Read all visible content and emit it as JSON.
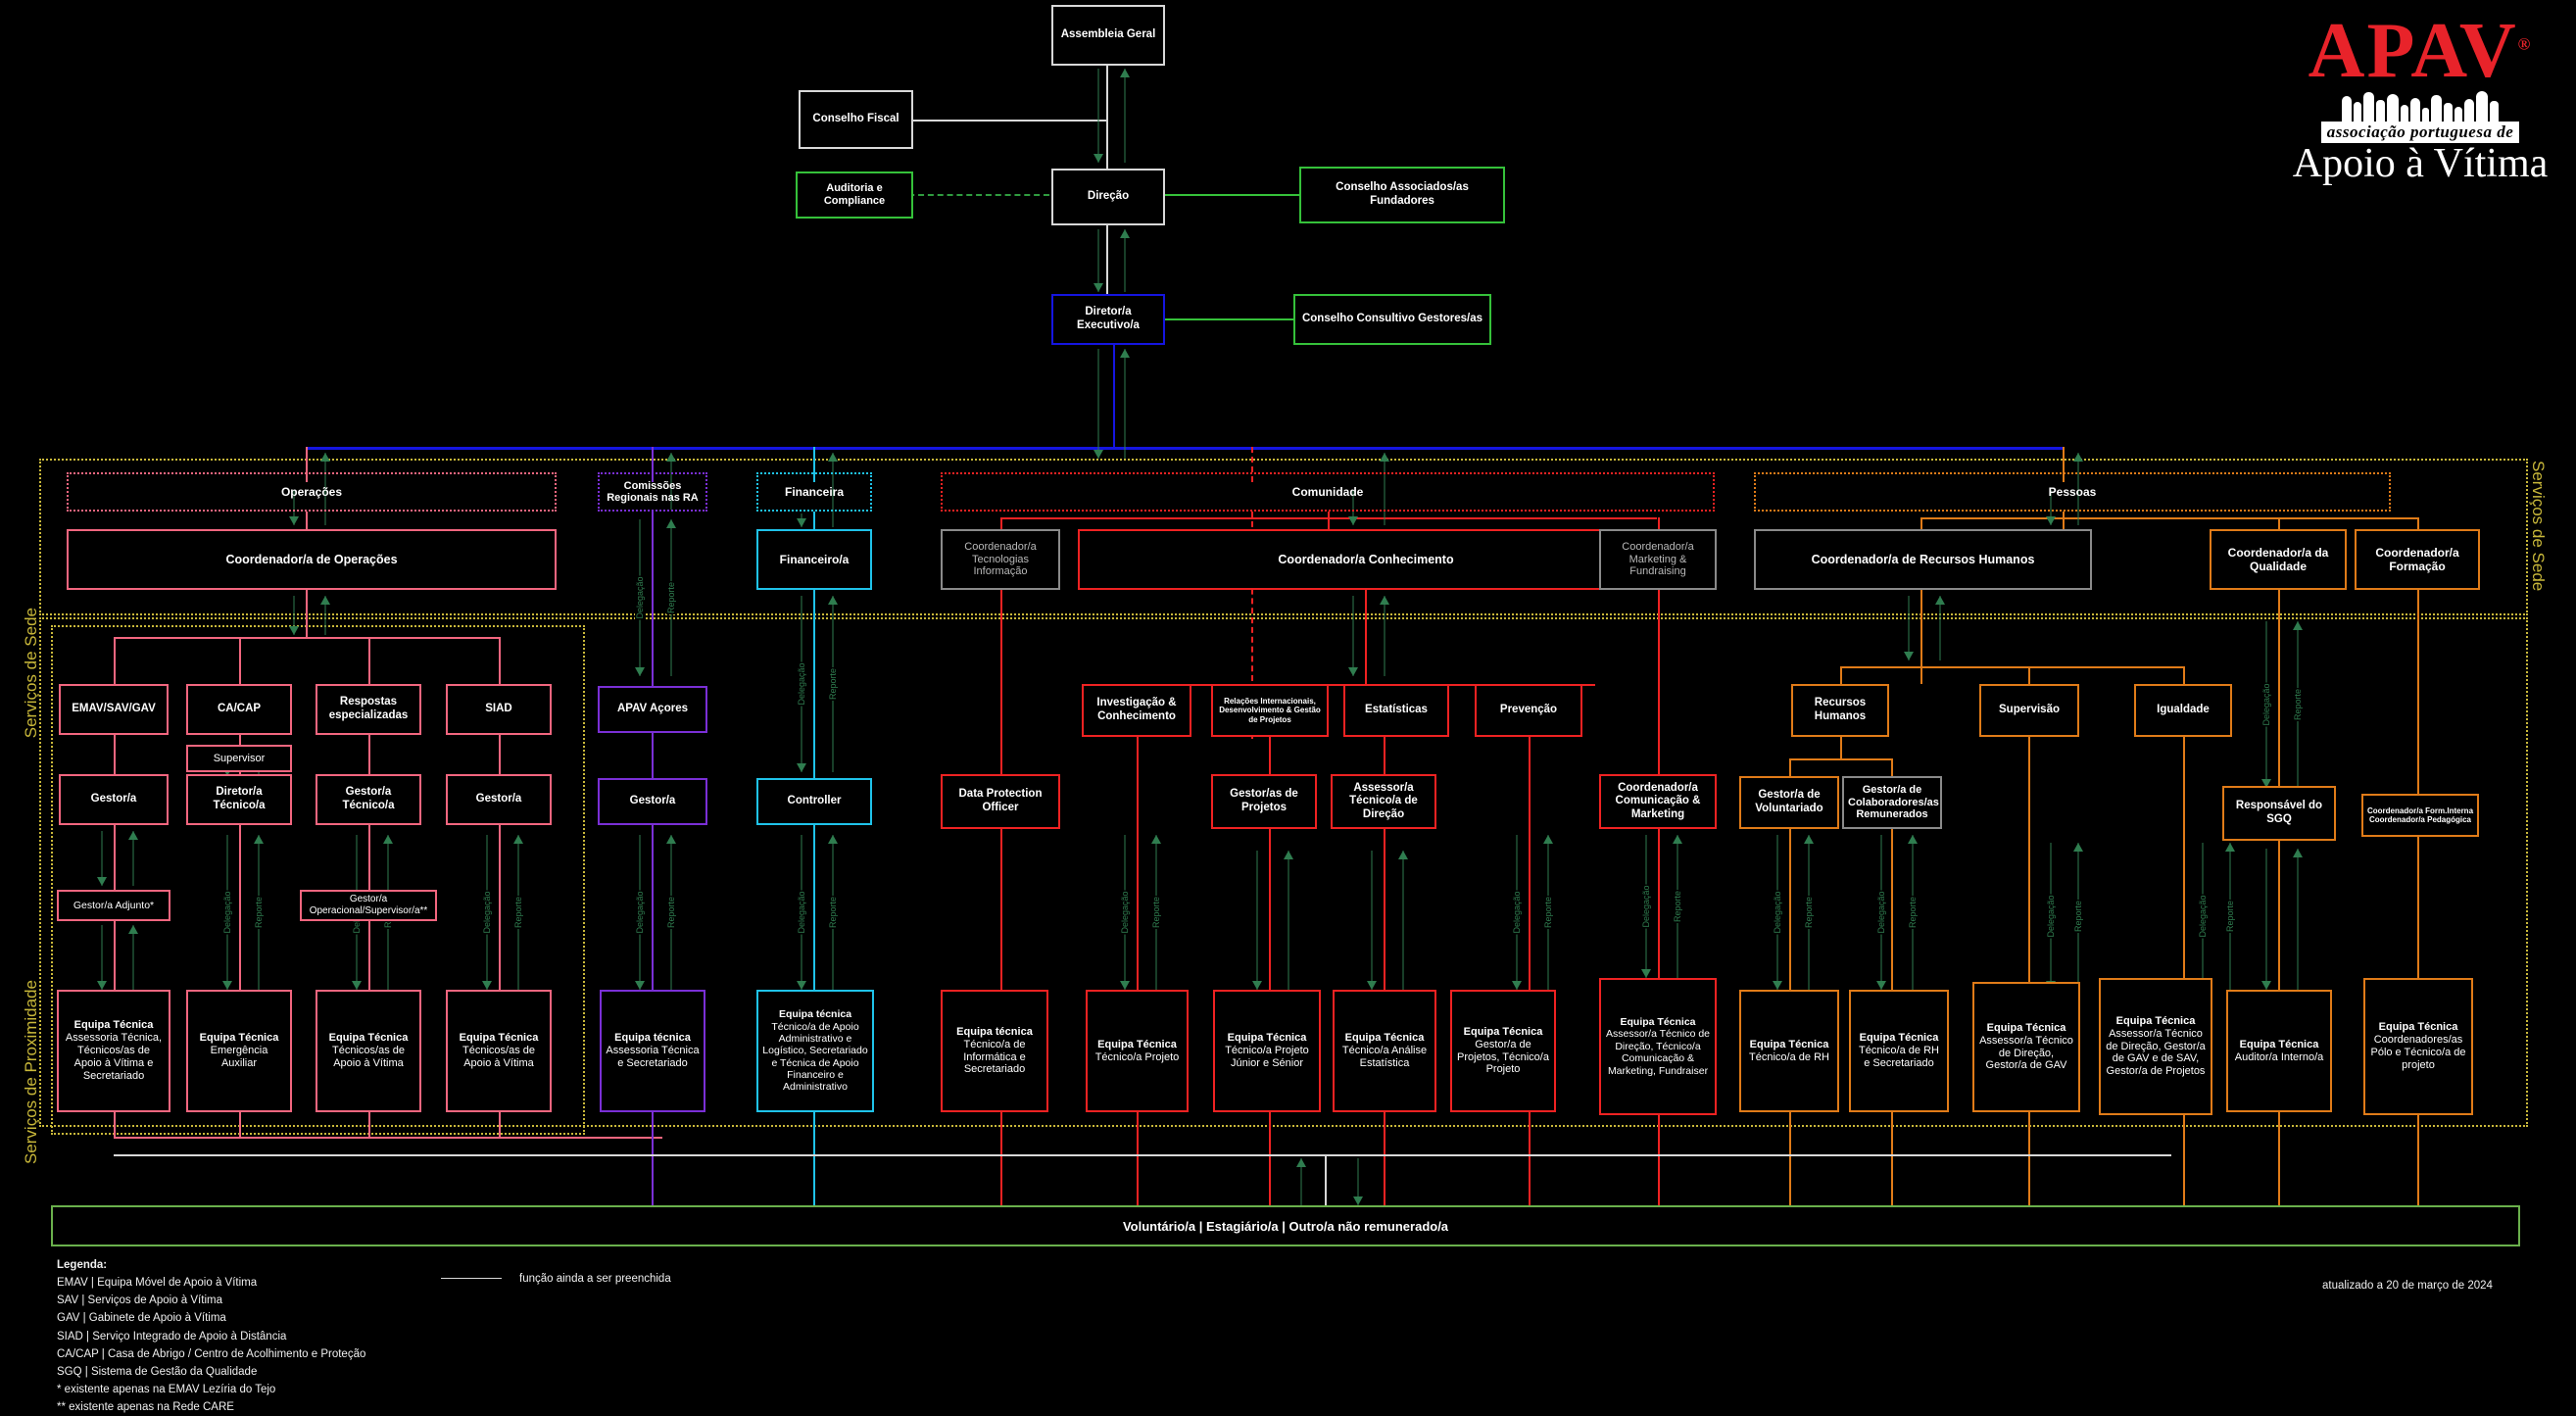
{
  "logo": {
    "word": "APAV",
    "registered": "®",
    "assoc": "associação portuguesa de",
    "sub": "Apoio à Vítima"
  },
  "colors": {
    "white": "#d8d8d8",
    "green": "#35c13a",
    "blue": "#1515e0",
    "pink": "#f2667f",
    "purple": "#7a2fd6",
    "cyan": "#1fc3ea",
    "red": "#ef2222",
    "orange": "#e07b18",
    "grey": "#8a8a8a",
    "yellow_band": "#c9b83a",
    "arrow_green": "#2f7d4f",
    "bottom_green": "#6ab04c"
  },
  "governance": {
    "assembleia_geral": "Assembleia Geral",
    "conselho_fiscal": "Conselho Fiscal",
    "auditoria_compliance": "Auditoria e Compliance",
    "direcao": "Direção",
    "conselho_associados": "Conselho Associados/as Fundadores",
    "diretor_executivo": "Diretor/a Executivo/a",
    "conselho_consultivo": "Conselho Consultivo Gestores/as"
  },
  "side_labels": {
    "sede_left": "Serviços de Sede",
    "proximidade_left": "Serviços de Proximidade",
    "sede_right": "Serviços de Sede"
  },
  "bands": {
    "operacoes": "Operações",
    "comissoes": "Comissões Regionais nas RA",
    "financeira": "Financeira",
    "comunidade": "Comunidade",
    "pessoas": "Pessoas"
  },
  "coordinators": {
    "operacoes": "Coordenador/a de Operações",
    "financeiro": "Financeiro/a",
    "tecnologias": "Coordenador/a Tecnologias Informação",
    "conhecimento": "Coordenador/a Conhecimento",
    "marketing": "Coordenador/a Marketing & Fundraising",
    "rh": "Coordenador/a de Recursos Humanos",
    "qualidade": "Coordenador/a da Qualidade",
    "formacao": "Coordenador/a Formação"
  },
  "operations": {
    "services": [
      "EMAV/SAV/GAV",
      "CA/CAP",
      "Respostas especializadas",
      "SIAD"
    ],
    "supervisor": "Supervisor",
    "managers": [
      "Gestor/a",
      "Diretor/a Técnico/a",
      "Gestor/a Técnico/a",
      "Gestor/a"
    ],
    "gestor_adjunto": "Gestor/a Adjunto*",
    "gestor_operacional": "Gestor/a Operacional/Supervisor/a**",
    "teams": [
      {
        "title": "Equipa Técnica",
        "lines": [
          "Assessoria Técnica, Técnicos/as de Apoio à Vítima e Secretariado"
        ]
      },
      {
        "title": "Equipa Técnica",
        "lines": [
          "Emergência",
          "Auxiliar"
        ]
      },
      {
        "title": "Equipa Técnica",
        "lines": [
          "Técnicos/as de Apoio à Vítima"
        ]
      },
      {
        "title": "Equipa Técnica",
        "lines": [
          "Técnicos/as de Apoio à Vítima"
        ]
      }
    ]
  },
  "regional": {
    "apav_acores": "APAV Açores",
    "gestor": "Gestor/a",
    "team": {
      "title": "Equipa técnica",
      "lines": [
        "Assessoria Técnica e Secretariado"
      ]
    }
  },
  "financial": {
    "controller": "Controller",
    "team": {
      "title": "Equipa técnica",
      "lines": [
        "Técnico/a de Apoio Administrativo e Logístico, Secretariado e Técnica de Apoio Financeiro e Administrativo"
      ]
    }
  },
  "it": {
    "dpo": "Data Protection Officer",
    "team": {
      "title": "Equipa técnica",
      "lines": [
        "Técnico/a de Informática e Secretariado"
      ]
    }
  },
  "community": {
    "units": [
      "Investigação & Conhecimento",
      "Relações Internacionais, Desenvolvimento & Gestão de Projetos",
      "Estatísticas",
      "Prevenção"
    ],
    "roles": [
      "Gestor/as de Projetos",
      "Assessor/a Técnico/a de Direção"
    ],
    "teams": [
      {
        "title": "Equipa Técnica",
        "lines": [
          "Técnico/a Projeto"
        ]
      },
      {
        "title": "Equipa Técnica",
        "lines": [
          "Técnico/a Projeto Júnior e Sénior"
        ]
      },
      {
        "title": "Equipa Técnica",
        "lines": [
          "Técnico/a Análise Estatística"
        ]
      },
      {
        "title": "Equipa Técnica",
        "lines": [
          "Gestor/a de Projetos, Técnico/a Projeto"
        ]
      }
    ]
  },
  "marketing": {
    "coordinator": "Coordenador/a Comunicação & Marketing",
    "team": {
      "title": "Equipa Técnica",
      "lines": [
        "Assessor/a Técnico de Direção, Técnico/a Comunicação & Marketing, Fundraiser"
      ]
    }
  },
  "people": {
    "units": [
      "Recursos Humanos",
      "Supervisão",
      "Igualdade"
    ],
    "roles": [
      "Gestor/a de Voluntariado",
      "Gestor/a de Colaboradores/as Remunerados"
    ],
    "teams": [
      {
        "title": "Equipa Técnica",
        "lines": [
          "Técnico/a de RH"
        ]
      },
      {
        "title": "Equipa Técnica",
        "lines": [
          "Técnico/a de RH e Secretariado"
        ]
      },
      {
        "title": "Equipa Técnica",
        "lines": [
          "Assessor/a Técnico de Direção, Gestor/a de GAV"
        ]
      },
      {
        "title": "Equipa Técnica",
        "lines": [
          "Assessor/a Técnico de Direção, Gestor/a de GAV e de SAV, Gestor/a de Projetos"
        ]
      }
    ]
  },
  "quality": {
    "responsavel_sgq": "Responsável do SGQ",
    "coordenador_form": "Coordenador/a Form.Interna Coordenador/a Pedagógica",
    "teams": [
      {
        "title": "Equipa Técnica",
        "lines": [
          "Auditor/a Interno/a"
        ]
      },
      {
        "title": "Equipa Técnica",
        "lines": [
          "Coordenadores/as Pólo e Técnico/a de projeto"
        ]
      }
    ]
  },
  "bottom_bar": "Voluntário/a | Estagiário/a | Outro/a não remunerado/a",
  "arrow_labels": {
    "delegacao": "Delegação",
    "reporte": "Reporte"
  },
  "legend": {
    "title": "Legenda:",
    "items": [
      "EMAV | Equipa Móvel de Apoio à Vítima",
      "SAV | Serviços de Apoio à Vítima",
      "GAV | Gabinete de Apoio à Vítima",
      "SIAD | Serviço Integrado de Apoio à Distância",
      "CA/CAP | Casa de Abrigo / Centro de Acolhimento e Proteção",
      "SGQ | Sistema de Gestão da Qualidade",
      "*    existente apenas na EMAV Lezíria do Tejo",
      "** existente apenas na Rede CARE"
    ],
    "line_note": "função ainda a ser preenchida"
  },
  "date_stamp": "atualizado a 20 de março de 2024"
}
